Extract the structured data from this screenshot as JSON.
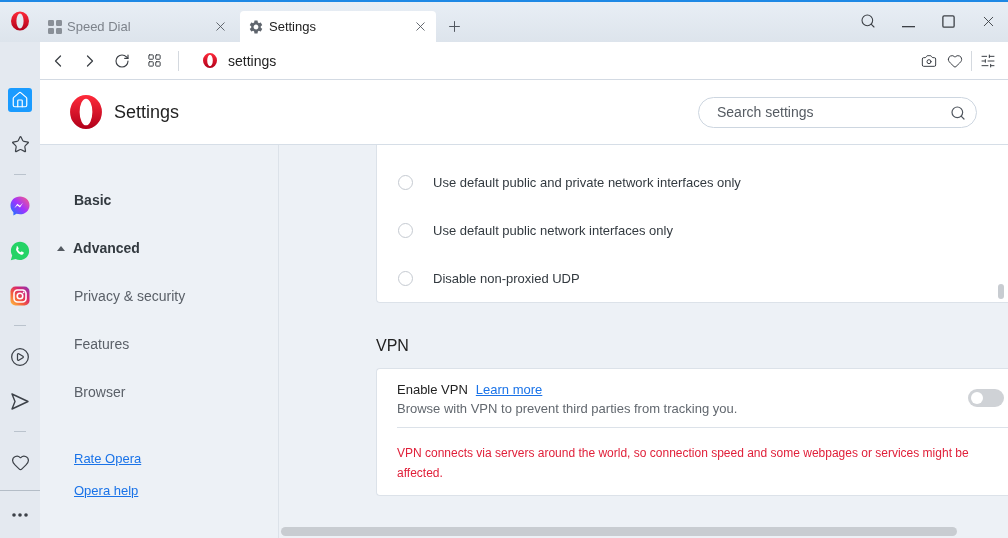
{
  "browser": {
    "tabs": [
      {
        "kind": "speed-dial",
        "title": "Speed Dial",
        "selected": false
      },
      {
        "kind": "settings",
        "title": "Settings",
        "selected": true
      }
    ]
  },
  "address_bar": {
    "url": "settings"
  },
  "sidebar": {
    "items": [
      {
        "selected": true
      },
      {
        "selected": false
      },
      {
        "selected": false
      },
      {
        "selected": false
      },
      {
        "selected": false
      },
      {
        "selected": false
      },
      {
        "selected": false
      },
      {
        "selected": false
      }
    ]
  },
  "settings": {
    "title": "Settings",
    "search": {
      "placeholder": "Search settings"
    },
    "nav": {
      "basic": "Basic",
      "advanced": {
        "label": "Advanced",
        "expanded": true,
        "items": [
          "Privacy & security",
          "Features",
          "Browser"
        ]
      },
      "links": [
        "Rate Opera",
        "Opera help"
      ]
    },
    "radio_card": {
      "options": [
        {
          "label": "Use default public and private network interfaces only",
          "selected": false
        },
        {
          "label": "Use default public network interfaces only",
          "selected": false
        },
        {
          "label": "Disable non-proxied UDP",
          "selected": false
        }
      ]
    },
    "vpn": {
      "heading": "VPN",
      "title": "Enable VPN",
      "link": "Learn more",
      "description": "Browse with VPN to prevent third parties from tracking you.",
      "on": false,
      "warning": "VPN connects via servers around the world, so connection speed and some webpages or services might be affected."
    }
  }
}
